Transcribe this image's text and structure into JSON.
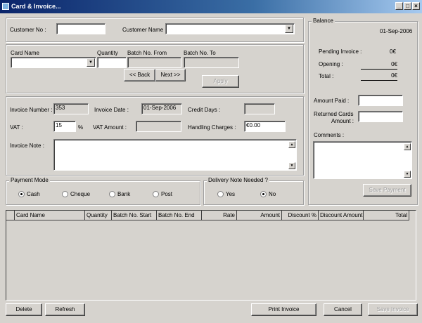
{
  "window": {
    "title": "Card & Invoice...",
    "min": "_",
    "max": "□",
    "close": "×"
  },
  "customer": {
    "no_label": "Customer No :",
    "no_value": "",
    "name_label": "Customer Name",
    "name_value": ""
  },
  "card": {
    "name_label": "Card Name",
    "quantity_label": "Quantity",
    "batch_from_label": "Batch No. From",
    "batch_to_label": "Batch No. To",
    "back": "<< Back",
    "next": "Next >>",
    "apply": "Apply"
  },
  "invoice": {
    "number_label": "Invoice Number :",
    "number_value": "353",
    "date_label": "Invoice Date :",
    "date_value": "01-Sep-2006",
    "credit_days_label": "Credit Days :",
    "vat_label": "VAT :",
    "vat_value": "15",
    "percent": "%",
    "vat_amount_label": "VAT Amount :",
    "handling_label": "Handling Charges :",
    "handling_value": "€0.00",
    "note_label": "Invoice Note :"
  },
  "payment": {
    "legend": "Payment Mode",
    "options": [
      "Cash",
      "Cheque",
      "Bank",
      "Post"
    ],
    "selected": "Cash"
  },
  "delivery": {
    "legend": "Delivery Note Needed ?",
    "options": [
      "Yes",
      "No"
    ],
    "selected": "No"
  },
  "balance": {
    "legend": "Balance",
    "date": "01-Sep-2006",
    "pending_label": "Pending Invoice :",
    "pending_value": "0€",
    "opening_label": "Opening :",
    "opening_value": "0€",
    "total_label": "Total :",
    "total_value": "0€",
    "amount_paid_label": "Amount Paid :",
    "returned_label_1": "Returned Cards",
    "returned_label_2": "Amount :",
    "comments_label": "Comments :",
    "save_payment": "Save Payment"
  },
  "grid": {
    "columns": [
      "Card Name",
      "Quantity",
      "Batch No. Start",
      "Batch No. End",
      "Rate",
      "Amount",
      "Discount %",
      "Discount Amount",
      "Total"
    ]
  },
  "buttons": {
    "delete": "Delete",
    "refresh": "Refresh",
    "print": "Print Invoice",
    "cancel": "Cancel",
    "save": "Save Invoice"
  }
}
